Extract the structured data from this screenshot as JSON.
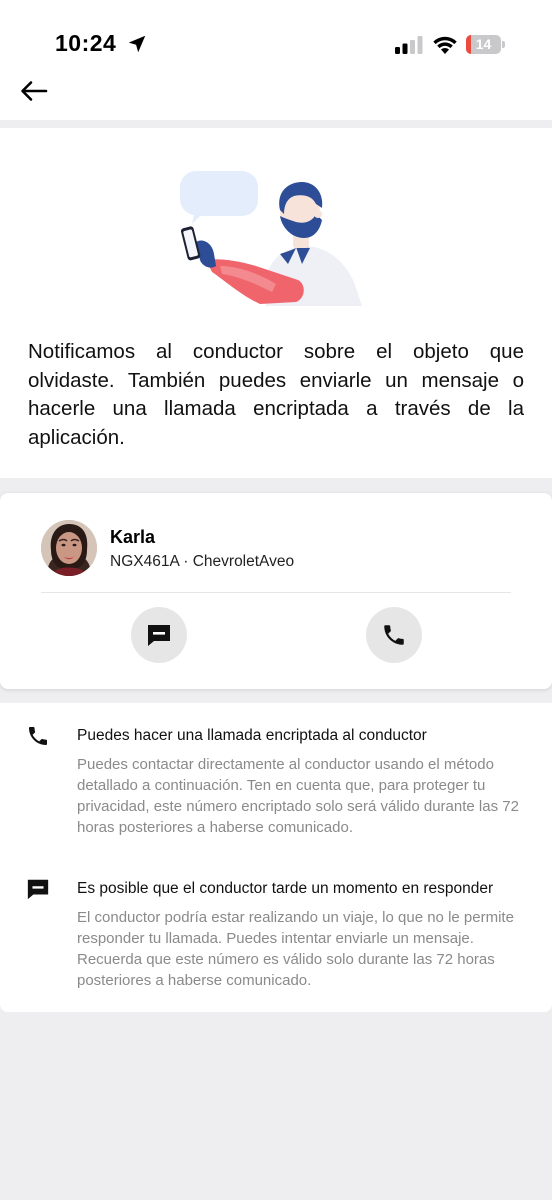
{
  "status_bar": {
    "time": "10:24",
    "battery_level": "14",
    "battery_color": "#ea4b3d"
  },
  "header": {
    "back_icon": "arrow-left-icon"
  },
  "notice": {
    "text": "Notificamos al conductor sobre el objeto que olvidaste. También puedes enviarle un mensaje o hacerle una llamada encriptada a través de la aplicación."
  },
  "driver": {
    "name": "Karla",
    "plate": "NGX461A",
    "separator": " · ",
    "vehicle": "ChevroletAveo",
    "actions": {
      "message_icon": "message-icon",
      "call_icon": "phone-icon"
    }
  },
  "info": [
    {
      "icon": "phone-icon",
      "title": "Puedes hacer una llamada encriptada al conductor",
      "body": "Puedes contactar directamente al conductor usando el método detallado a continuación. Ten en cuenta que, para proteger tu privacidad, este número encriptado solo será válido durante las 72 horas posteriores a haberse comunicado."
    },
    {
      "icon": "message-icon",
      "title": "Es posible que el conductor tarde un momento en responder",
      "body": "El conductor podría estar realizando un viaje, lo que no le permite responder tu llamada. Puedes intentar enviarle un mensaje. Recuerda que este número es válido solo durante las 72 horas posteriores a haberse comunicado."
    }
  ]
}
